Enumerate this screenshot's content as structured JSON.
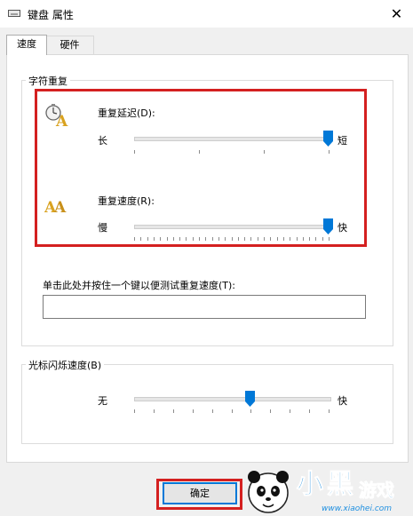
{
  "window": {
    "title": "键盘 属性",
    "close_glyph": "✕"
  },
  "tabs": [
    {
      "label": "速度",
      "active": true
    },
    {
      "label": "硬件",
      "active": false
    }
  ],
  "char_repeat": {
    "group_label": "字符重复",
    "delay": {
      "label": "重复延迟(D):",
      "min_label": "长",
      "max_label": "短",
      "value_fraction": 1.0
    },
    "rate": {
      "label": "重复速度(R):",
      "min_label": "慢",
      "max_label": "快",
      "value_fraction": 1.0
    },
    "test": {
      "label": "单击此处并按住一个键以便测试重复速度(T):",
      "value": ""
    }
  },
  "cursor_blink": {
    "group_label": "光标闪烁速度(B)",
    "min_label": "无",
    "max_label": "快",
    "value_fraction": 0.6
  },
  "buttons": {
    "ok_label": "确定"
  },
  "watermark": {
    "brand_text": "小黑游戏",
    "url_text": "www.xiaohei.com"
  },
  "colors": {
    "highlight_red": "#d42020",
    "accent_blue": "#0078d7",
    "slider_thumb": "#0078d7"
  }
}
